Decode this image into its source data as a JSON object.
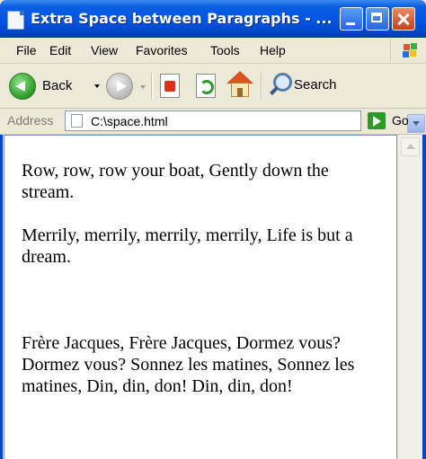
{
  "window": {
    "title": "Extra Space between Paragraphs - ..."
  },
  "menu": {
    "file": "File",
    "edit": "Edit",
    "view": "View",
    "favorites": "Favorites",
    "tools": "Tools",
    "help": "Help"
  },
  "toolbar": {
    "back_label": "Back",
    "search_label": "Search"
  },
  "address": {
    "label": "Address",
    "value": "C:\\space.html",
    "go_label": "Go"
  },
  "page": {
    "paragraph_1": "Row, row, row your boat, Gently down the stream.",
    "paragraph_2": "Merrily, merrily, merrily, merrily, Life is but a dream.",
    "paragraph_3": "Frère Jacques, Frère Jacques, Dormez vous? Dormez vous? Sonnez les matines, Sonnez les matines, Din, din, don! Din, din, don!"
  },
  "colors": {
    "titlebar": "#0055e5",
    "chrome": "#ece9d8",
    "content_bg": "#ffffff"
  }
}
